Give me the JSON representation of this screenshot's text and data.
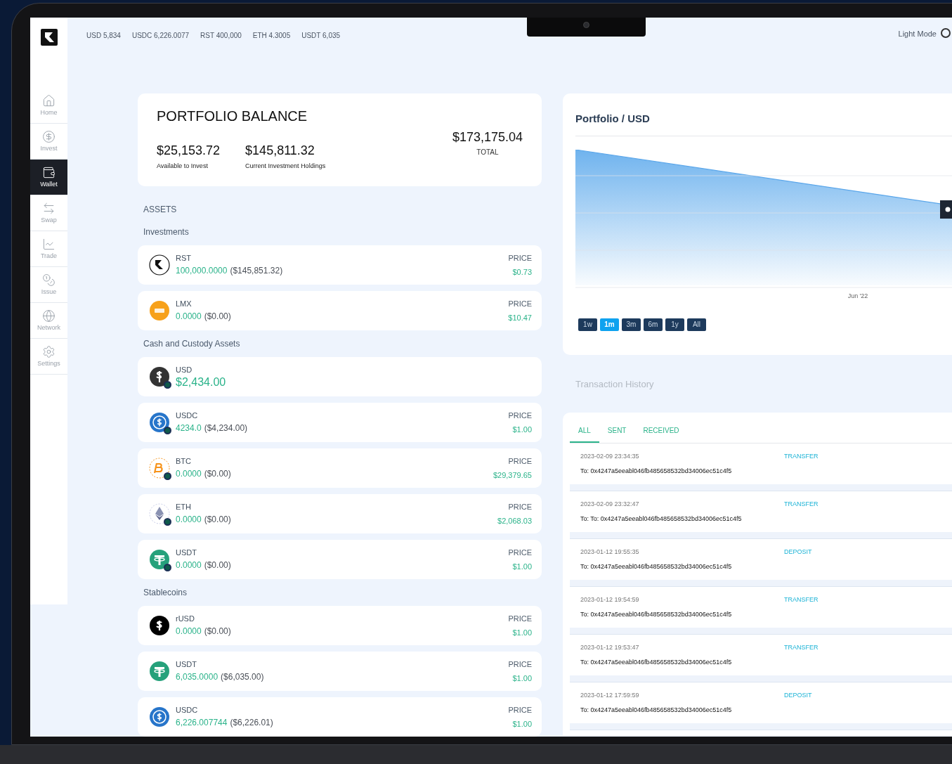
{
  "top_balances": [
    "USD 5,834",
    "USDC 6,226.0077",
    "RST 400,000",
    "ETH 4.3005",
    "USDT 6,035"
  ],
  "theme_toggle": {
    "label": "Light Mode"
  },
  "sidebar": {
    "items": [
      {
        "label": "Home",
        "selected": false
      },
      {
        "label": "Invest",
        "selected": false
      },
      {
        "label": "Wallet",
        "selected": true
      },
      {
        "label": "Swap",
        "selected": false
      },
      {
        "label": "Trade",
        "selected": false
      },
      {
        "label": "Issue",
        "selected": false
      },
      {
        "label": "Network",
        "selected": false
      },
      {
        "label": "Settings",
        "selected": false
      }
    ]
  },
  "balance": {
    "title": "PORTFOLIO BALANCE",
    "available": "$25,153.72",
    "available_label": "Available to Invest",
    "holdings": "$145,811.32",
    "holdings_label": "Current Investment Holdings",
    "total": "$173,175.04",
    "total_label": "TOTAL"
  },
  "assets_title": "ASSETS",
  "sections": [
    {
      "title": "Investments",
      "assets": [
        {
          "kind": "rst",
          "symbol": "RST",
          "amount": "100,000.0000",
          "value": "($145,851.32)",
          "price_label": "PRICE",
          "price": "$0.73",
          "custody_badge": false
        },
        {
          "kind": "lmx",
          "symbol": "LMX",
          "amount": "0.0000",
          "value": "($0.00)",
          "price_label": "PRICE",
          "price": "$10.47",
          "custody_badge": false
        }
      ]
    },
    {
      "title": "Cash and Custody Assets",
      "assets": [
        {
          "kind": "usd",
          "symbol": "USD",
          "amount": "$2,434.00",
          "custody_badge": true
        },
        {
          "kind": "usdc",
          "symbol": "USDC",
          "amount": "4234.0",
          "value": "($4,234.00)",
          "price_label": "PRICE",
          "price": "$1.00",
          "custody_badge": true
        },
        {
          "kind": "btc",
          "symbol": "BTC",
          "amount": "0.0000",
          "value": "($0.00)",
          "price_label": "PRICE",
          "price": "$29,379.65",
          "custody_badge": true
        },
        {
          "kind": "eth",
          "symbol": "ETH",
          "amount": "0.0000",
          "value": "($0.00)",
          "price_label": "PRICE",
          "price": "$2,068.03",
          "custody_badge": true
        },
        {
          "kind": "usdt",
          "symbol": "USDT",
          "amount": "0.0000",
          "value": "($0.00)",
          "price_label": "PRICE",
          "price": "$1.00",
          "custody_badge": true
        }
      ]
    },
    {
      "title": "Stablecoins",
      "assets": [
        {
          "kind": "rusd",
          "symbol": "rUSD",
          "amount": "0.0000",
          "value": "($0.00)",
          "price_label": "PRICE",
          "price": "$1.00",
          "custody_badge": false
        },
        {
          "kind": "usdt",
          "symbol": "USDT",
          "amount": "6,035.0000",
          "value": "($6,035.00)",
          "price_label": "PRICE",
          "price": "$1.00",
          "custody_badge": false
        },
        {
          "kind": "usdc",
          "symbol": "USDC",
          "amount": "6,226.007744",
          "value": "($6,226.01)",
          "price_label": "PRICE",
          "price": "$1.00",
          "custody_badge": false
        }
      ]
    }
  ],
  "chart": {
    "title": "Portfolio / USD",
    "x_label": "Jun '22",
    "ranges": [
      {
        "label": "1w",
        "selected": false
      },
      {
        "label": "1m",
        "selected": true
      },
      {
        "label": "3m",
        "selected": false
      },
      {
        "label": "6m",
        "selected": false
      },
      {
        "label": "1y",
        "selected": false
      },
      {
        "label": "All",
        "selected": false
      }
    ]
  },
  "transactions": {
    "title": "Transaction History",
    "tabs": [
      {
        "label": "ALL",
        "selected": true
      },
      {
        "label": "SENT",
        "selected": false
      },
      {
        "label": "RECEIVED",
        "selected": false
      }
    ],
    "rows": [
      {
        "date": "2023-02-09 23:34:35",
        "type": "TRANSFER",
        "to": "To: 0x4247a5eeabl046fb485658532bd34006ec51c4f5"
      },
      {
        "date": "2023-02-09 23:32:47",
        "type": "TRANSFER",
        "to": "To: To: 0x4247a5eeabl046fb485658532bd34006ec51c4f5"
      },
      {
        "date": "2023-01-12 19:55:35",
        "type": "DEPOSIT",
        "to": "To: 0x4247a5eeabl046fb485658532bd34006ec51c4f5"
      },
      {
        "date": "2023-01-12 19:54:59",
        "type": "TRANSFER",
        "to": "To: 0x4247a5eeabl046fb485658532bd34006ec51c4f5"
      },
      {
        "date": "2023-01-12 19:53:47",
        "type": "TRANSFER",
        "to": "To: 0x4247a5eeabl046fb485658532bd34006ec51c4f5"
      },
      {
        "date": "2023-01-12 17:59:59",
        "type": "DEPOSIT",
        "to": "To: 0x4247a5eeabl046fb485658532bd34006ec51c4f5"
      }
    ]
  }
}
